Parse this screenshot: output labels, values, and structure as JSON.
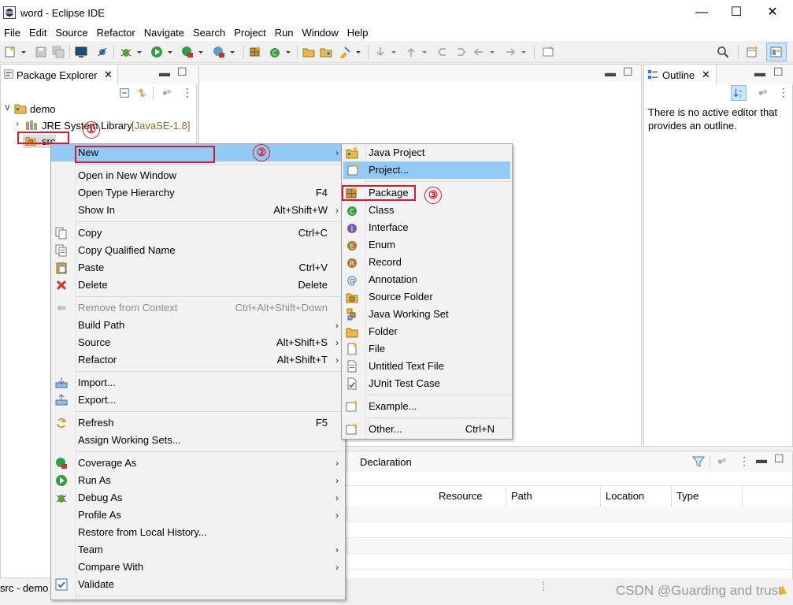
{
  "window": {
    "title": "word - Eclipse IDE",
    "controls": {
      "minimize": "—",
      "maximize": "☐",
      "close": "✕"
    }
  },
  "menubar": [
    "File",
    "Edit",
    "Source",
    "Refactor",
    "Navigate",
    "Search",
    "Project",
    "Run",
    "Window",
    "Help"
  ],
  "package_explorer": {
    "tab_label": "Package Explorer",
    "tree": {
      "project": "demo",
      "library": "JRE System Library",
      "library_version": "[JavaSE-1.8]",
      "src": "src"
    }
  },
  "outline": {
    "tab_label": "Outline",
    "message_line1": "There is no active editor that",
    "message_line2": "provides an outline."
  },
  "bottom_panel": {
    "tab_label": "Declaration",
    "columns": [
      "Resource",
      "Path",
      "Location",
      "Type"
    ]
  },
  "status_bar": {
    "selection": "src - demo"
  },
  "annotations": {
    "step1": "①",
    "step2": "②",
    "step3": "③"
  },
  "context_menu": {
    "items": [
      {
        "label": "New",
        "accel": "",
        "submenu": true,
        "icon": "none"
      },
      {
        "label": "Open in New Window",
        "accel": "",
        "submenu": false
      },
      {
        "label": "Open Type Hierarchy",
        "accel": "F4",
        "submenu": false
      },
      {
        "label": "Show In",
        "accel": "Alt+Shift+W",
        "submenu": true
      },
      {
        "label": "Copy",
        "accel": "Ctrl+C",
        "submenu": false,
        "icon": "copy-icon"
      },
      {
        "label": "Copy Qualified Name",
        "accel": "",
        "submenu": false,
        "icon": "copy-qualified-name-icon"
      },
      {
        "label": "Paste",
        "accel": "Ctrl+V",
        "submenu": false,
        "icon": "paste-icon"
      },
      {
        "label": "Delete",
        "accel": "Delete",
        "submenu": false,
        "icon": "delete-icon"
      },
      {
        "label": "Remove from Context",
        "accel": "Ctrl+Alt+Shift+Down",
        "submenu": false,
        "disabled": true,
        "icon": "remove-context-icon"
      },
      {
        "label": "Build Path",
        "accel": "",
        "submenu": true
      },
      {
        "label": "Source",
        "accel": "Alt+Shift+S",
        "submenu": true
      },
      {
        "label": "Refactor",
        "accel": "Alt+Shift+T",
        "submenu": true
      },
      {
        "label": "Import...",
        "accel": "",
        "submenu": false,
        "icon": "import-icon"
      },
      {
        "label": "Export...",
        "accel": "",
        "submenu": false,
        "icon": "export-icon"
      },
      {
        "label": "Refresh",
        "accel": "F5",
        "submenu": false,
        "icon": "refresh-icon"
      },
      {
        "label": "Assign Working Sets...",
        "accel": "",
        "submenu": false
      },
      {
        "label": "Coverage As",
        "accel": "",
        "submenu": true,
        "icon": "coverage-icon"
      },
      {
        "label": "Run As",
        "accel": "",
        "submenu": true,
        "icon": "run-icon"
      },
      {
        "label": "Debug As",
        "accel": "",
        "submenu": true,
        "icon": "debug-icon"
      },
      {
        "label": "Profile As",
        "accel": "",
        "submenu": true
      },
      {
        "label": "Restore from Local History...",
        "accel": "",
        "submenu": false
      },
      {
        "label": "Team",
        "accel": "",
        "submenu": true
      },
      {
        "label": "Compare With",
        "accel": "",
        "submenu": true
      },
      {
        "label": "Validate",
        "accel": "",
        "submenu": false,
        "icon": "checkbox-icon"
      }
    ]
  },
  "new_submenu": {
    "items": [
      {
        "label": "Java Project",
        "accel": ""
      },
      {
        "label": "Project...",
        "accel": ""
      },
      {
        "label": "Package",
        "accel": ""
      },
      {
        "label": "Class",
        "accel": ""
      },
      {
        "label": "Interface",
        "accel": ""
      },
      {
        "label": "Enum",
        "accel": ""
      },
      {
        "label": "Record",
        "accel": ""
      },
      {
        "label": "Annotation",
        "accel": ""
      },
      {
        "label": "Source Folder",
        "accel": ""
      },
      {
        "label": "Java Working Set",
        "accel": ""
      },
      {
        "label": "Folder",
        "accel": ""
      },
      {
        "label": "File",
        "accel": ""
      },
      {
        "label": "Untitled Text File",
        "accel": ""
      },
      {
        "label": "JUnit Test Case",
        "accel": ""
      },
      {
        "label": "Example...",
        "accel": ""
      },
      {
        "label": "Other...",
        "accel": "Ctrl+N"
      }
    ]
  },
  "watermark": "CSDN @Guarding and trust",
  "colors": {
    "highlight": "#91c9f7",
    "annotation_red": "#e0162b",
    "disabled": "#8c8c8c"
  }
}
